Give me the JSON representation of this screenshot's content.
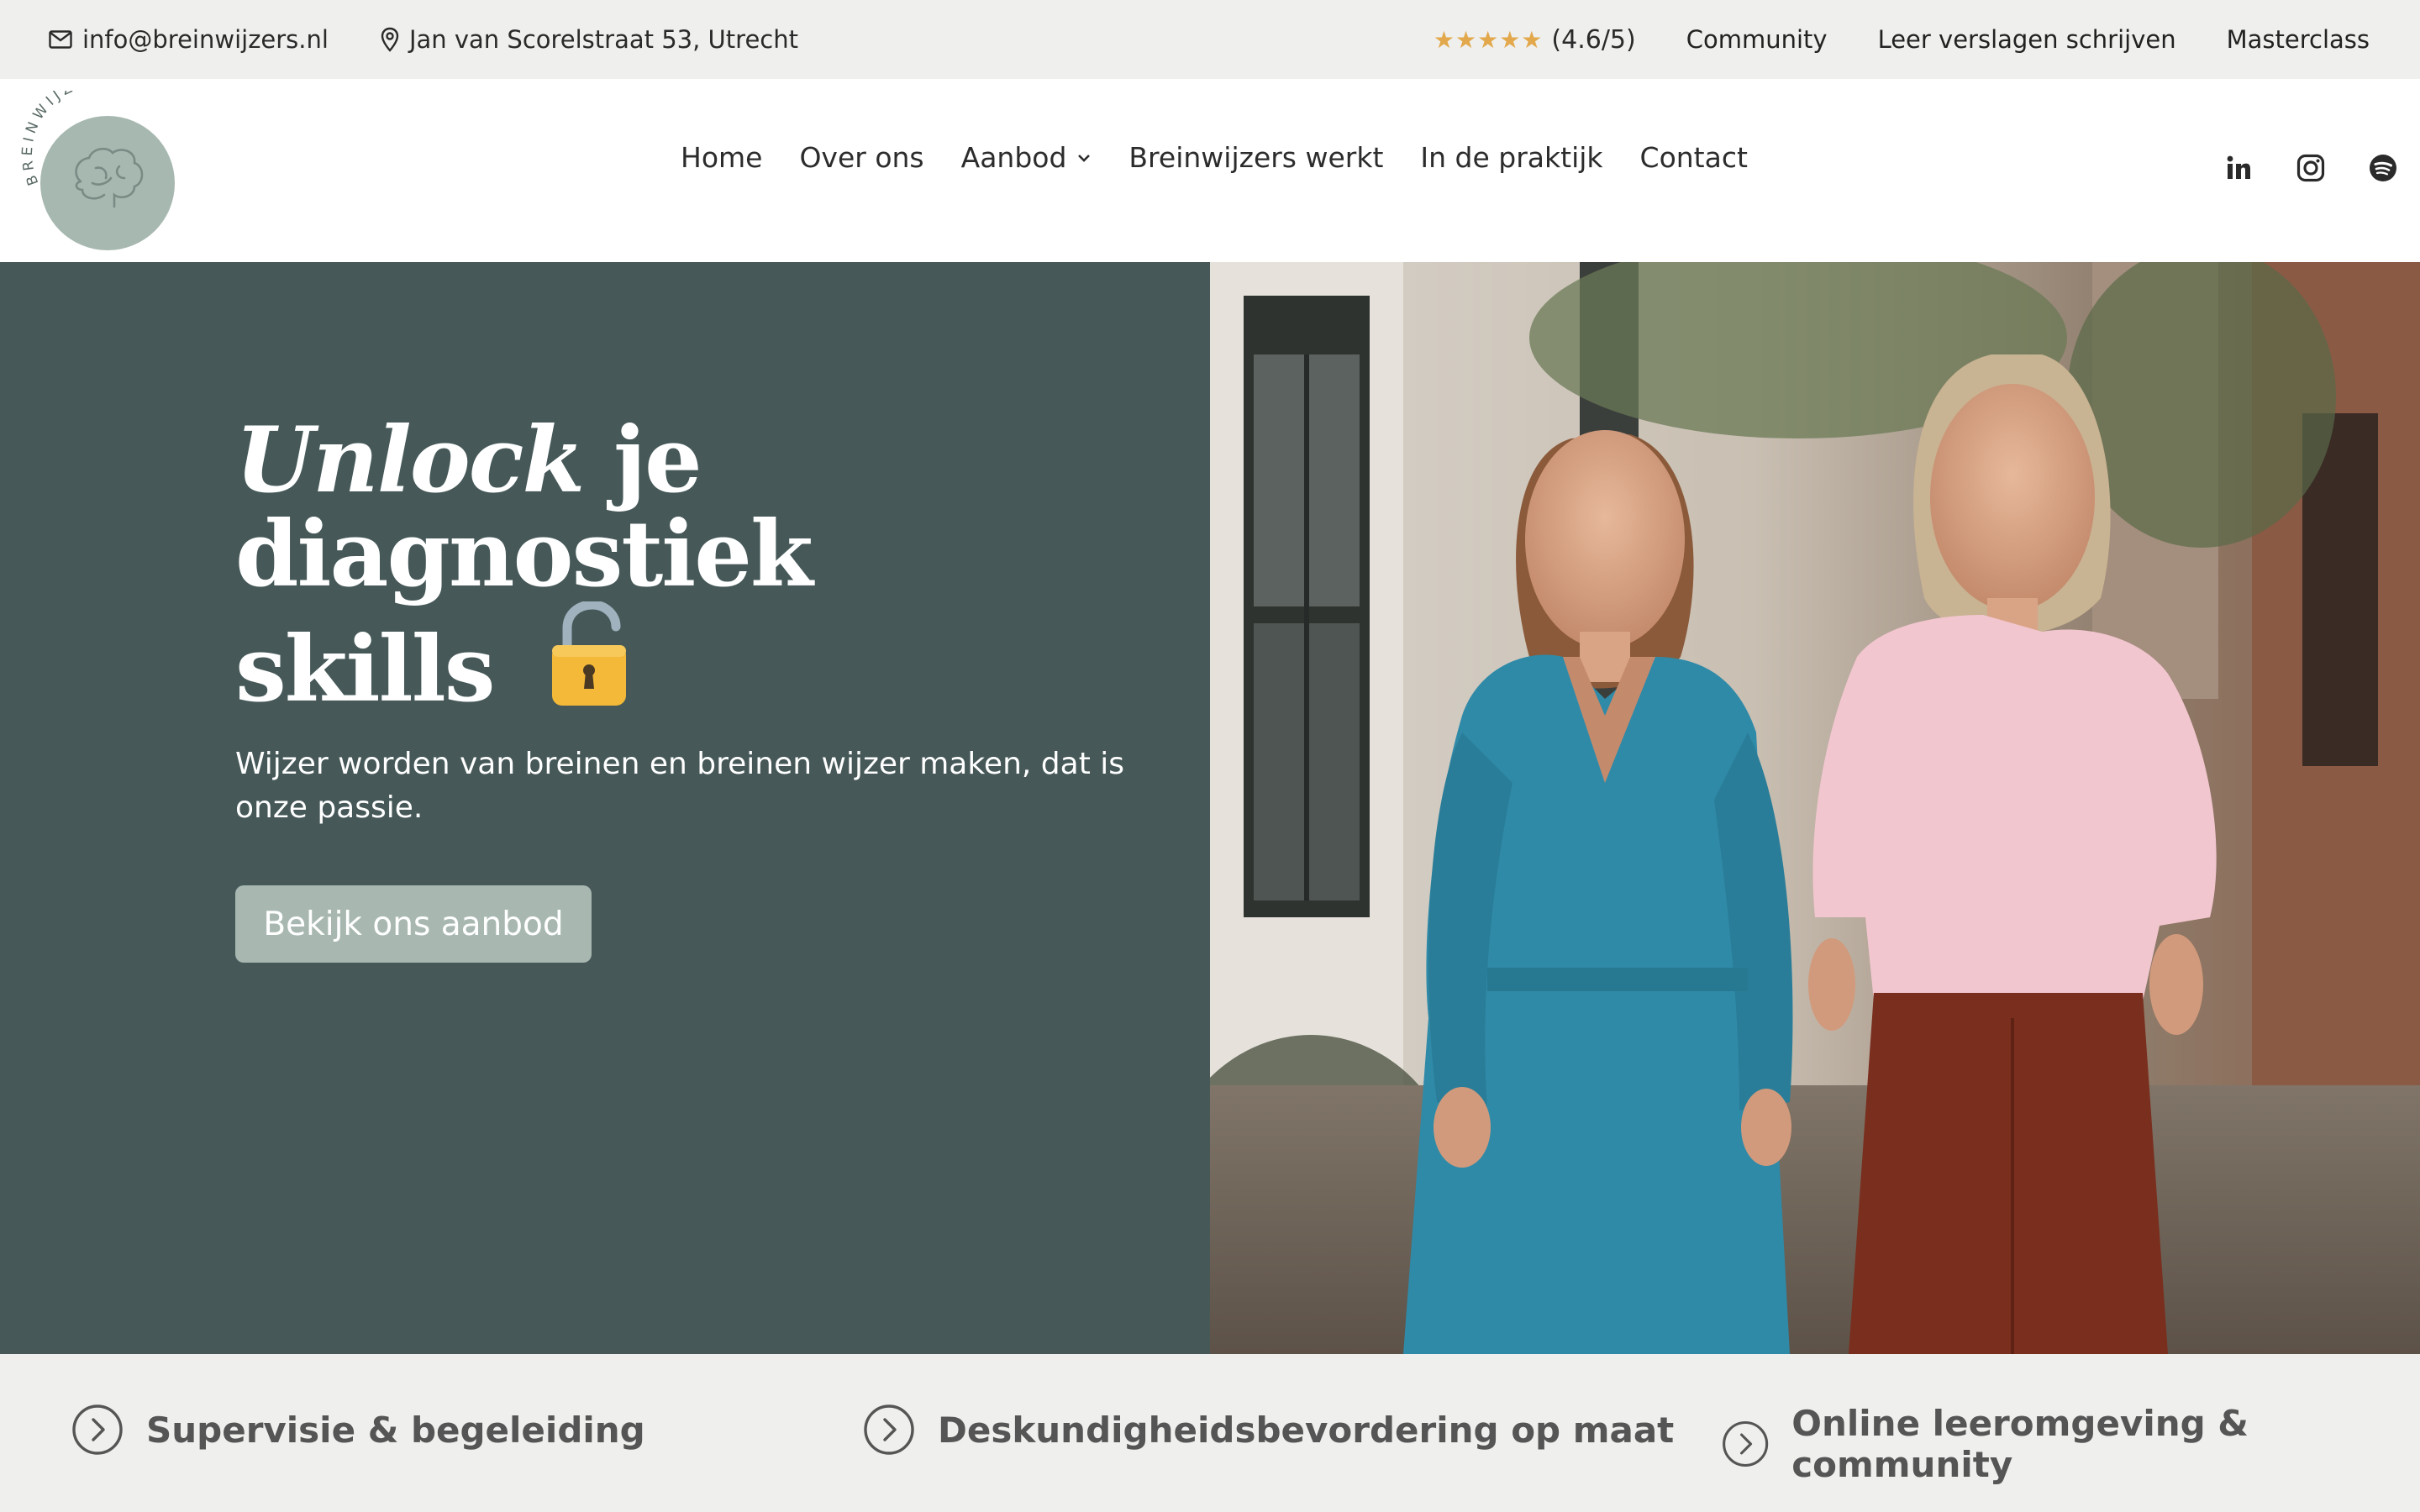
{
  "topbar": {
    "email": "info@breinwijzers.nl",
    "address": "Jan van Scorelstraat 53, Utrecht",
    "rating_stars": "★★★★★",
    "rating_value": "(4.6/5)",
    "links": [
      "Community",
      "Leer verslagen schrijven",
      "Masterclass"
    ]
  },
  "logo": {
    "text": "BREINWIJZERS"
  },
  "nav": {
    "items": [
      "Home",
      "Over ons",
      "Aanbod",
      "Breinwijzers werkt",
      "In de praktijk",
      "Contact"
    ]
  },
  "social": [
    "linkedin-icon",
    "instagram-icon",
    "spotify-icon"
  ],
  "hero": {
    "title_em": "Unlock",
    "title_rest1": " je",
    "title_line2": "diagnostiek",
    "title_line3": "skills",
    "subtitle": "Wijzer worden van breinen en breinen wijzer maken, dat is onze passie.",
    "cta": "Bekijk ons aanbod"
  },
  "features": [
    "Supervisie & begeleiding",
    "Deskundigheidsbevordering op maat",
    "Online leeromgeving & community"
  ],
  "colors": {
    "hero_bg": "#465858",
    "cta_bg": "#a8b8b1",
    "logo_circle": "#a7b8b0",
    "topbar_bg": "#efefed",
    "star": "#e2a84b"
  }
}
